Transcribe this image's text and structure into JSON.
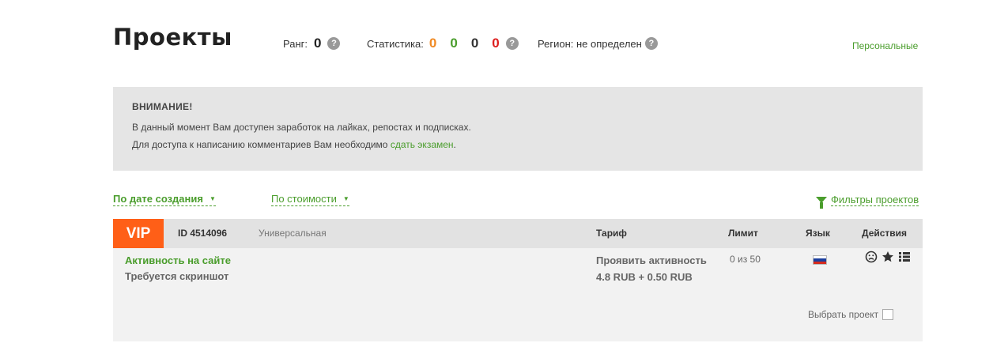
{
  "header": {
    "title": "Проекты",
    "rank_label": "Ранг:",
    "rank_value": "0",
    "help_glyph": "?",
    "stats_label": "Статистика:",
    "stats": [
      {
        "value": "0",
        "color": "#f08a24"
      },
      {
        "value": "0",
        "color": "#4a9d2c"
      },
      {
        "value": "0",
        "color": "#333333"
      },
      {
        "value": "0",
        "color": "#dd1e1e"
      }
    ],
    "region_text": "Регион: не определен",
    "personal_link": "Персональные"
  },
  "notice": {
    "heading": "ВНИМАНИЕ!",
    "line1": "В данный момент Вам доступен заработок на лайках, репостах и подписках.",
    "line2_prefix": "Для доступа к написанию комментариев Вам необходимо ",
    "line2_link": "сдать экзамен",
    "line2_suffix": "."
  },
  "sort": {
    "by_date": "По дате создания",
    "by_cost": "По стоимости",
    "caret": "▼",
    "filters": "Фильтры проектов"
  },
  "table": {
    "badge": "VIP",
    "id_label": "ID 4514096",
    "type_label": "Универсальная",
    "col_tariff": "Тариф",
    "col_limit": "Лимит",
    "col_lang": "Язык",
    "col_actions": "Действия"
  },
  "project": {
    "title": "Активность на сайте",
    "subtitle": "Требуется скриншот",
    "tariff_name": "Проявить активность",
    "tariff_price": "4.8 RUB + 0.50 RUB",
    "limit": "0 из 50",
    "language_flag": [
      "#ffffff",
      "#1c3f9e",
      "#d52b1e"
    ],
    "actions_icons": [
      "frown-icon",
      "star-icon",
      "list-icon"
    ],
    "select_label": "Выбрать проект"
  },
  "colors": {
    "accent": "#4a9d2c",
    "vip": "#ff5f17"
  }
}
